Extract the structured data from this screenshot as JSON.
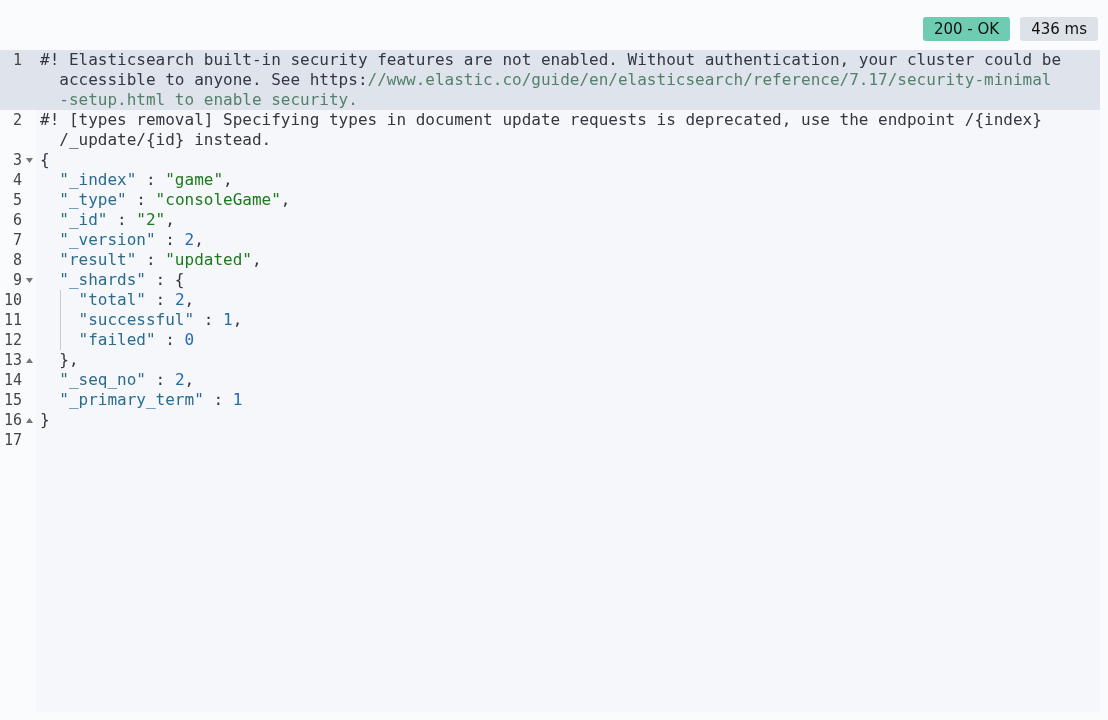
{
  "status_badge": {
    "text": "200 - OK",
    "color": "#6dccb1"
  },
  "time_badge": {
    "text": "436 ms"
  },
  "lines": [
    {
      "number": "1",
      "active": true,
      "fold_start": false,
      "fold_end": false,
      "guide": false,
      "rows": [
        [
          {
            "kind": "comment",
            "text": "#! Elasticsearch built-in security features are not enabled. Without authentication, your cluster could be"
          }
        ],
        [
          {
            "kind": "comment",
            "text": "  accessible to anyone. See https:"
          },
          {
            "kind": "link",
            "text": "//www.elastic.co/guide/en/elasticsearch/reference/7.17/security-minimal"
          }
        ],
        [
          {
            "kind": "link",
            "text": "  -setup.html to enable security."
          }
        ]
      ]
    },
    {
      "number": "2",
      "active": false,
      "fold_start": false,
      "fold_end": false,
      "guide": false,
      "rows": [
        [
          {
            "kind": "comment",
            "text": "#! [types removal] Specifying types in document update requests is deprecated, use the endpoint /{index}"
          }
        ],
        [
          {
            "kind": "comment",
            "text": "  /_update/{id} instead."
          }
        ]
      ]
    },
    {
      "number": "3",
      "active": false,
      "fold_start": true,
      "fold_end": false,
      "guide": false,
      "rows": [
        [
          {
            "kind": "punct",
            "text": "{"
          }
        ]
      ]
    },
    {
      "number": "4",
      "active": false,
      "fold_start": false,
      "fold_end": false,
      "guide": false,
      "rows": [
        [
          {
            "kind": "key",
            "text": "  \"_index\""
          },
          {
            "kind": "punct",
            "text": " : "
          },
          {
            "kind": "string",
            "text": "\"game\""
          },
          {
            "kind": "punct",
            "text": ","
          }
        ]
      ]
    },
    {
      "number": "5",
      "active": false,
      "fold_start": false,
      "fold_end": false,
      "guide": false,
      "rows": [
        [
          {
            "kind": "key",
            "text": "  \"_type\""
          },
          {
            "kind": "punct",
            "text": " : "
          },
          {
            "kind": "string",
            "text": "\"consoleGame\""
          },
          {
            "kind": "punct",
            "text": ","
          }
        ]
      ]
    },
    {
      "number": "6",
      "active": false,
      "fold_start": false,
      "fold_end": false,
      "guide": false,
      "rows": [
        [
          {
            "kind": "key",
            "text": "  \"_id\""
          },
          {
            "kind": "punct",
            "text": " : "
          },
          {
            "kind": "string",
            "text": "\"2\""
          },
          {
            "kind": "punct",
            "text": ","
          }
        ]
      ]
    },
    {
      "number": "7",
      "active": false,
      "fold_start": false,
      "fold_end": false,
      "guide": false,
      "rows": [
        [
          {
            "kind": "key",
            "text": "  \"_version\""
          },
          {
            "kind": "punct",
            "text": " : "
          },
          {
            "kind": "number",
            "text": "2"
          },
          {
            "kind": "punct",
            "text": ","
          }
        ]
      ]
    },
    {
      "number": "8",
      "active": false,
      "fold_start": false,
      "fold_end": false,
      "guide": false,
      "rows": [
        [
          {
            "kind": "key",
            "text": "  \"result\""
          },
          {
            "kind": "punct",
            "text": " : "
          },
          {
            "kind": "string",
            "text": "\"updated\""
          },
          {
            "kind": "punct",
            "text": ","
          }
        ]
      ]
    },
    {
      "number": "9",
      "active": false,
      "fold_start": true,
      "fold_end": false,
      "guide": false,
      "rows": [
        [
          {
            "kind": "key",
            "text": "  \"_shards\""
          },
          {
            "kind": "punct",
            "text": " : {"
          }
        ]
      ]
    },
    {
      "number": "10",
      "active": false,
      "fold_start": false,
      "fold_end": false,
      "guide": true,
      "rows": [
        [
          {
            "kind": "key",
            "text": "    \"total\""
          },
          {
            "kind": "punct",
            "text": " : "
          },
          {
            "kind": "number",
            "text": "2"
          },
          {
            "kind": "punct",
            "text": ","
          }
        ]
      ]
    },
    {
      "number": "11",
      "active": false,
      "fold_start": false,
      "fold_end": false,
      "guide": true,
      "rows": [
        [
          {
            "kind": "key",
            "text": "    \"successful\""
          },
          {
            "kind": "punct",
            "text": " : "
          },
          {
            "kind": "number",
            "text": "1"
          },
          {
            "kind": "punct",
            "text": ","
          }
        ]
      ]
    },
    {
      "number": "12",
      "active": false,
      "fold_start": false,
      "fold_end": false,
      "guide": true,
      "rows": [
        [
          {
            "kind": "key",
            "text": "    \"failed\""
          },
          {
            "kind": "punct",
            "text": " : "
          },
          {
            "kind": "number",
            "text": "0"
          }
        ]
      ]
    },
    {
      "number": "13",
      "active": false,
      "fold_start": false,
      "fold_end": true,
      "guide": false,
      "rows": [
        [
          {
            "kind": "punct",
            "text": "  },"
          }
        ]
      ]
    },
    {
      "number": "14",
      "active": false,
      "fold_start": false,
      "fold_end": false,
      "guide": false,
      "rows": [
        [
          {
            "kind": "key",
            "text": "  \"_seq_no\""
          },
          {
            "kind": "punct",
            "text": " : "
          },
          {
            "kind": "number",
            "text": "2"
          },
          {
            "kind": "punct",
            "text": ","
          }
        ]
      ]
    },
    {
      "number": "15",
      "active": false,
      "fold_start": false,
      "fold_end": false,
      "guide": false,
      "rows": [
        [
          {
            "kind": "key",
            "text": "  \"_primary_term\""
          },
          {
            "kind": "punct",
            "text": " : "
          },
          {
            "kind": "number",
            "text": "1"
          }
        ]
      ]
    },
    {
      "number": "16",
      "active": false,
      "fold_start": false,
      "fold_end": true,
      "guide": false,
      "rows": [
        [
          {
            "kind": "punct",
            "text": "}"
          }
        ]
      ]
    },
    {
      "number": "17",
      "active": false,
      "fold_start": false,
      "fold_end": false,
      "guide": false,
      "rows": [
        []
      ]
    }
  ]
}
